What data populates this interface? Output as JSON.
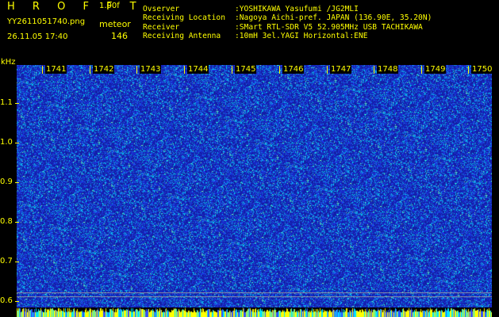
{
  "header": {
    "brand": "H R O F F T",
    "version": "1.00f",
    "filename": "YY2611051740.png",
    "datetime": "26.11.05 17:40",
    "meteor_label": "meteor",
    "meteor_count": "146"
  },
  "info": [
    {
      "key": "Ovserver",
      "value": ":YOSHIKAWA Yasufumi /JG2MLI"
    },
    {
      "key": "Receiving Location",
      "value": ":Nagoya Aichi-pref. JAPAN (136.90E, 35.20N)"
    },
    {
      "key": "Receiver",
      "value": ":SMart RTL-SDR V5 52.905MHz USB TACHIKAWA"
    },
    {
      "key": "Receiving Antenna",
      "value": ":10mH 3el.YAGI Horizontal:ENE"
    }
  ],
  "y_axis": {
    "unit": "kHz",
    "labels": [
      "1.1",
      "1.0",
      "0.9",
      "0.8",
      "0.7",
      "0.6"
    ]
  },
  "x_axis": {
    "labels": [
      "1741",
      "1742",
      "1743",
      "1744",
      "1745",
      "1746",
      "1747",
      "1748",
      "1749",
      "1750"
    ]
  },
  "colors": {
    "text": "#ffff00",
    "background": "#000000",
    "noise_base": "#1a1aa0",
    "noise_high": "#00e5ff"
  }
}
